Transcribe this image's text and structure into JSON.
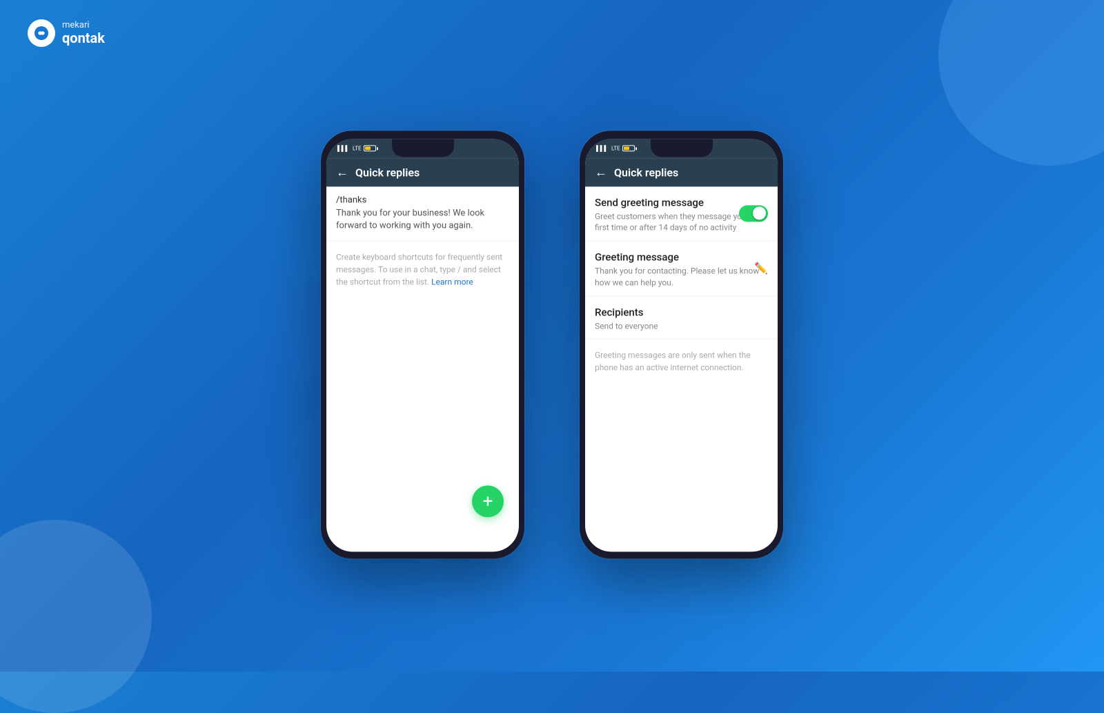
{
  "brand": {
    "mekari": "mekari",
    "qontak": "qontak"
  },
  "phone1": {
    "header_title": "Quick replies",
    "back_arrow": "←",
    "shortcut": "/thanks",
    "reply_text": "Thank you for your business! We look forward to working with you again.",
    "help_text": "Create keyboard shortcuts for frequently sent messages. To use in a chat, type / and select the shortcut from the list.",
    "learn_more": "Learn more",
    "fab_icon": "+"
  },
  "phone2": {
    "header_title": "Quick replies",
    "back_arrow": "←",
    "send_greeting_label": "Send greeting message",
    "send_greeting_sublabel": "Greet customers when they message you the first time or after 14 days of no activity",
    "greeting_message_label": "Greeting message",
    "greeting_message_text": "Thank you for contacting. Please let us know how we can help you.",
    "recipients_label": "Recipients",
    "recipients_sublabel": "Send to everyone",
    "footer_note": "Greeting messages are only sent when the phone has an active internet connection."
  }
}
